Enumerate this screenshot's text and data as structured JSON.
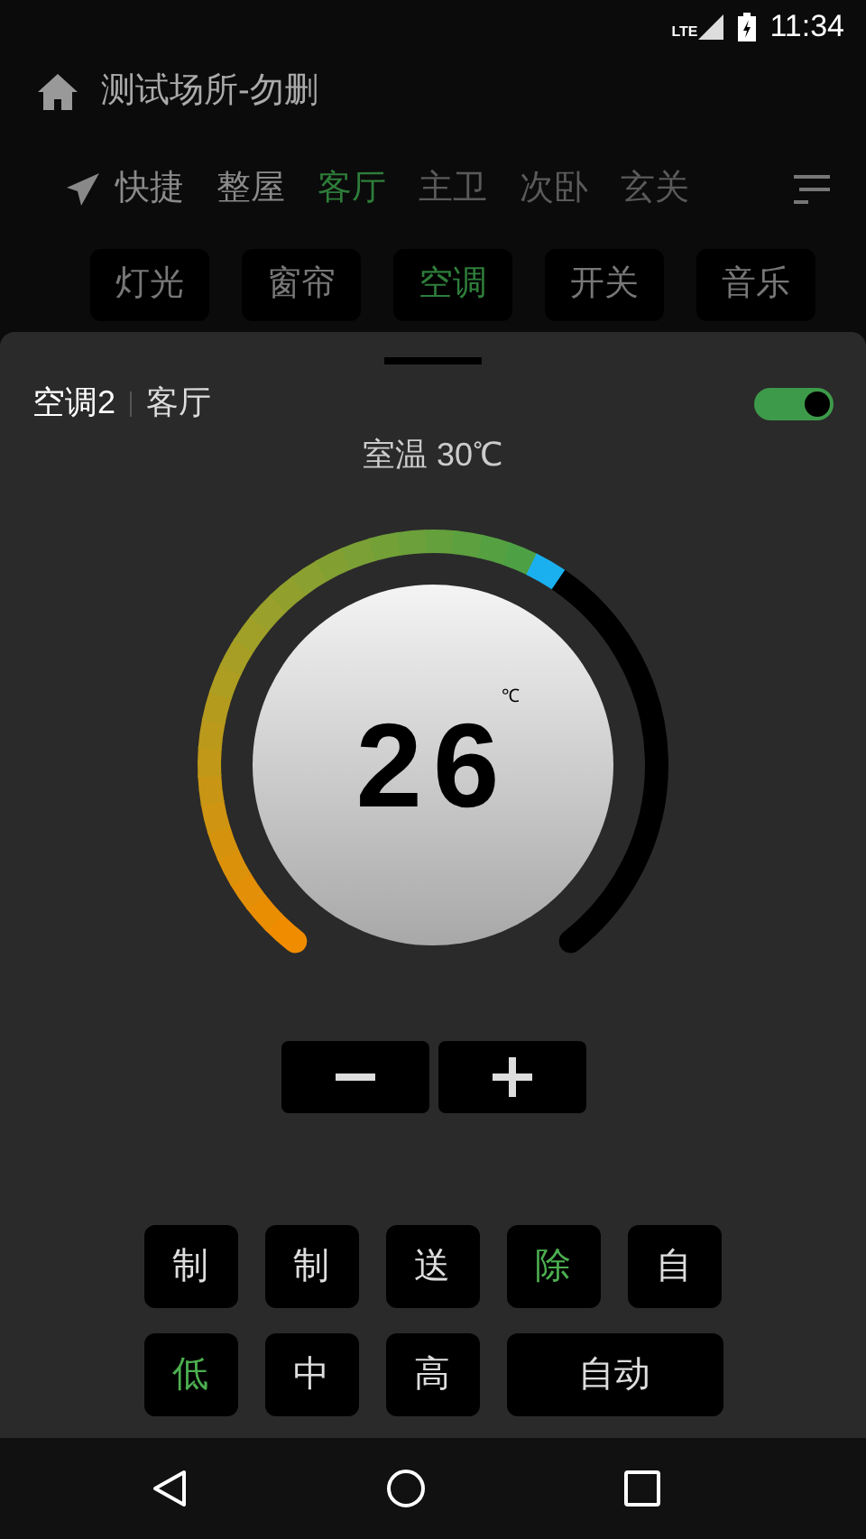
{
  "status_bar": {
    "network": "LTE",
    "time": "11:34"
  },
  "header": {
    "title": "测试场所-勿删"
  },
  "rooms": [
    {
      "label": "快捷",
      "selected": false
    },
    {
      "label": "整屋",
      "selected": false
    },
    {
      "label": "客厅",
      "selected": true
    },
    {
      "label": "主卫",
      "selected": false
    },
    {
      "label": "次卧",
      "selected": false
    },
    {
      "label": "玄关",
      "selected": false
    }
  ],
  "categories": [
    {
      "label": "灯光",
      "selected": false
    },
    {
      "label": "窗帘",
      "selected": false
    },
    {
      "label": "空调",
      "selected": true
    },
    {
      "label": "开关",
      "selected": false
    },
    {
      "label": "音乐",
      "selected": false
    }
  ],
  "device": {
    "name": "空调2",
    "room": "客厅",
    "on": true,
    "room_temp": "室温 30℃",
    "setpoint": "26",
    "unit": "℃"
  },
  "modes": [
    {
      "label": "制",
      "selected": false
    },
    {
      "label": "制",
      "selected": false
    },
    {
      "label": "送",
      "selected": false
    },
    {
      "label": "除",
      "selected": true
    },
    {
      "label": "自",
      "selected": false
    }
  ],
  "fan_speeds": [
    {
      "label": "低",
      "selected": true
    },
    {
      "label": "中",
      "selected": false
    },
    {
      "label": "高",
      "selected": false
    },
    {
      "label": "自动",
      "selected": false
    }
  ]
}
